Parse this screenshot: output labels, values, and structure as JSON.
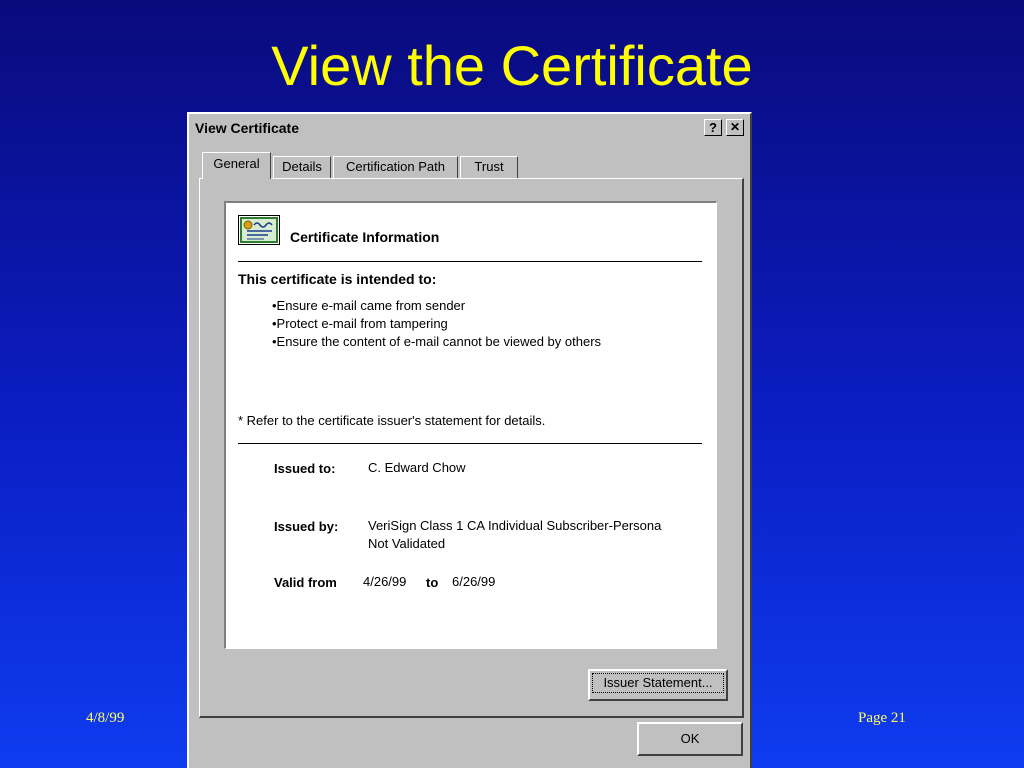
{
  "slide": {
    "title": "View the Certificate",
    "date": "4/8/99",
    "page": "Page  21"
  },
  "dialog": {
    "title": "View Certificate",
    "help_button": "?",
    "close_button": "✕",
    "tabs": [
      {
        "label": "General"
      },
      {
        "label": "Details"
      },
      {
        "label": "Certification Path"
      },
      {
        "label": "Trust"
      }
    ],
    "certificate_info_title": "Certificate Information",
    "intended_heading": "This certificate is intended to:",
    "purposes": [
      "•Ensure e-mail came from sender",
      "•Protect e-mail from tampering",
      "•Ensure the content of e-mail cannot be viewed by others"
    ],
    "footnote": "* Refer to the certificate issuer's statement for details.",
    "issued_to_label": "Issued to:",
    "issued_to_value": "C. Edward Chow",
    "issued_by_label": "Issued by:",
    "issued_by_value_line1": "VeriSign Class 1 CA Individual Subscriber-Persona",
    "issued_by_value_line2": "Not Validated",
    "valid_from_label": "Valid from",
    "valid_from_value": "4/26/99",
    "valid_to_label": "to",
    "valid_to_value": "6/26/99",
    "issuer_statement_button": "Issuer Statement...",
    "ok_button": "OK"
  },
  "colors": {
    "background_top": "#0a0a7c",
    "background_bottom": "#0e3cf0",
    "title": "#ffff00",
    "footer": "#ffff66",
    "dialog_face": "#c0c0c0"
  }
}
